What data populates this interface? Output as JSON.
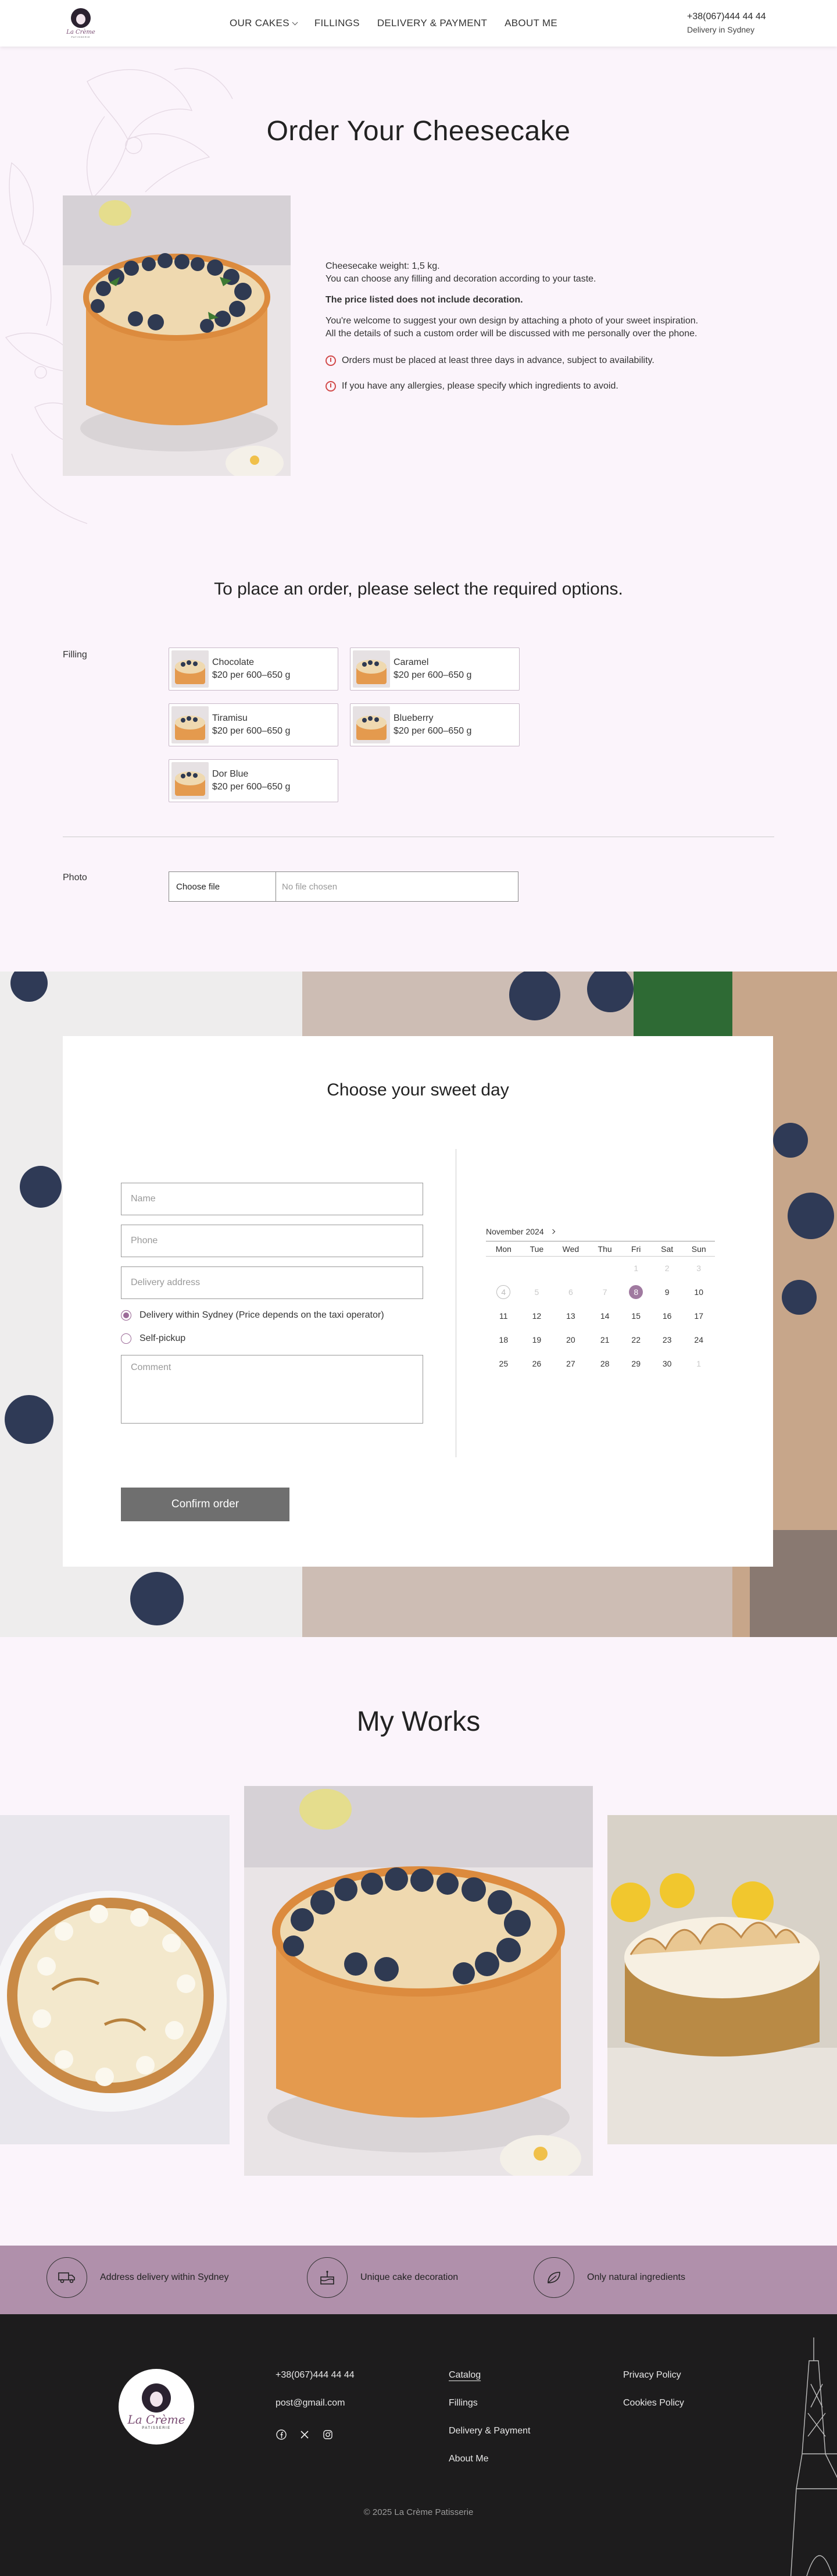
{
  "header": {
    "logo": {
      "script": "La Crème",
      "sub": "PATISSERIE"
    },
    "nav": [
      {
        "label": "OUR CAKES",
        "has_dropdown": true
      },
      {
        "label": "FILLINGS"
      },
      {
        "label": "DELIVERY & PAYMENT"
      },
      {
        "label": "ABOUT ME"
      }
    ],
    "phone": "+38(067)444 44 44",
    "delivery": "Delivery in Sydney"
  },
  "product": {
    "title": "Order Your Cheesecake",
    "weight": "Cheesecake weight: 1,5 kg.",
    "choose": "You can choose any filling and decoration according to your taste.",
    "price_note": "The price listed does not include decoration.",
    "suggest": "You're welcome to suggest your own design by attaching a photo of your sweet inspiration.",
    "details": "All the details of such a custom order will be discussed with me personally over the phone.",
    "warnings": [
      "Orders must be placed at least three days in advance, subject to availability.",
      "If you have any allergies, please specify which ingredients to avoid."
    ]
  },
  "options": {
    "heading": "To place an order, please select the required options.",
    "filling_label": "Filling",
    "fillings": [
      {
        "name": "Chocolate",
        "price": "$20 per 600–650 g"
      },
      {
        "name": "Caramel",
        "price": "$20 per 600–650 g"
      },
      {
        "name": "Tiramisu",
        "price": "$20 per 600–650 g"
      },
      {
        "name": "Blueberry",
        "price": "$20 per 600–650 g"
      },
      {
        "name": "Dor Blue",
        "price": "$20 per 600–650 g"
      }
    ],
    "photo_label": "Photo",
    "file_button": "Choose file",
    "file_status": "No file chosen"
  },
  "order": {
    "heading": "Choose your sweet day",
    "name_placeholder": "Name",
    "phone_placeholder": "Phone",
    "address_placeholder": "Delivery address",
    "delivery_option": "Delivery within Sydney (Price depends on the taxi operator)",
    "pickup_option": "Self-pickup",
    "comment_placeholder": "Comment",
    "confirm": "Confirm order",
    "calendar": {
      "month": "November 2024",
      "weekdays": [
        "Mon",
        "Tue",
        "Wed",
        "Thu",
        "Fri",
        "Sat",
        "Sun"
      ],
      "weeks": [
        [
          "",
          "",
          "",
          "",
          "1",
          "2",
          "3"
        ],
        [
          "4",
          "5",
          "6",
          "7",
          "8",
          "9",
          "10"
        ],
        [
          "11",
          "12",
          "13",
          "14",
          "15",
          "16",
          "17"
        ],
        [
          "18",
          "19",
          "20",
          "21",
          "22",
          "23",
          "24"
        ],
        [
          "25",
          "26",
          "27",
          "28",
          "29",
          "30",
          "1"
        ]
      ],
      "disabled": [
        "1",
        "2",
        "3",
        "5",
        "6",
        "7"
      ],
      "today": "4",
      "selected": "8"
    }
  },
  "works": {
    "title": "My Works"
  },
  "features": [
    {
      "icon": "delivery-truck-icon",
      "label": "Address delivery within Sydney"
    },
    {
      "icon": "cake-icon",
      "label": "Unique cake decoration"
    },
    {
      "icon": "leaf-icon",
      "label": "Only natural ingredients"
    }
  ],
  "footer": {
    "phone": "+38(067)444 44 44",
    "email": "post@gmail.com",
    "social": [
      "facebook-icon",
      "x-icon",
      "instagram-icon"
    ],
    "links": [
      "Catalog",
      "Fillings",
      "Delivery & Payment",
      "About Me"
    ],
    "legal": [
      "Privacy Policy",
      "Cookies Policy"
    ],
    "copyright": "© 2025 La Crème Patisserie"
  }
}
